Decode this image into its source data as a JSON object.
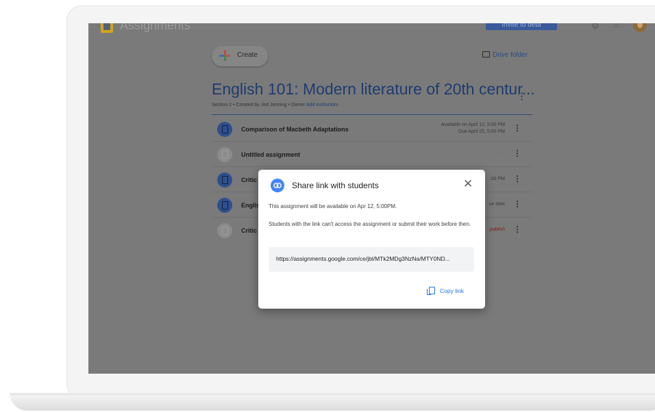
{
  "app": {
    "title": "Assignments",
    "invite_label": "Invite to beta"
  },
  "toolbar": {
    "create_label": "Create",
    "drive_folder_label": "Drive folder"
  },
  "course": {
    "title": "English 101: Modern literature of 20th centur...",
    "meta_section": "Section 2",
    "meta_created": "Created by Jed Jenning",
    "meta_owner": "Owner",
    "meta_add": "Add instructors"
  },
  "assignments": [
    {
      "title": "Comparison of Macbeth Adaptations",
      "status_line1": "Available on April 12, 5:00 PM",
      "status_line2": "Due April 25, 5:00 PM"
    },
    {
      "title": "Untitled assignment",
      "status_line1": "Draft"
    },
    {
      "title": "Critic",
      "status_line1": ":00 PM"
    },
    {
      "title": "Englis",
      "status_line1": "ue date"
    },
    {
      "title": "Critic",
      "status_line1": "publish"
    }
  ],
  "dialog": {
    "title": "Share link with students",
    "close_glyph": "✕",
    "line1": "This assignment will be available on Apr 12, 5:00PM.",
    "line2": "Students with the link can't access the assignment or submit their work before then.",
    "link": "https://assignments.google.com/ce/jbl/MTk2MDg3NzNa/MTY0ND...",
    "copy_label": "Copy link"
  },
  "icons": {
    "app": "assignments-logo-icon",
    "settings": "gear-icon",
    "apps": "apps-grid-icon",
    "link": "link-icon",
    "copy": "copy-icon",
    "folder": "folder-icon",
    "more": "kebab-menu-icon"
  },
  "colors": {
    "accent": "#1a73e8",
    "dialog_icon": "#4285f4",
    "course_title": "#1e3c70"
  }
}
